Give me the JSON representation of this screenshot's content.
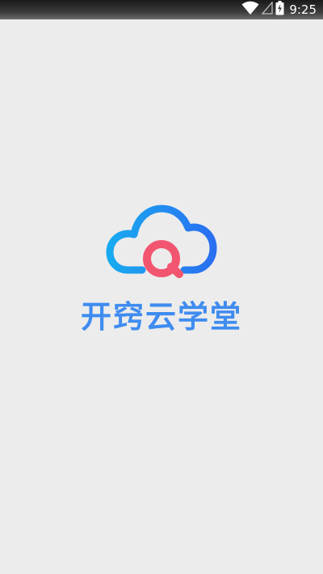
{
  "status_bar": {
    "time": "9:25",
    "icons": [
      "wifi-icon",
      "signal-icon",
      "battery-charging-icon"
    ]
  },
  "splash": {
    "app_name": "开窍云学堂",
    "logo_letter": "Q"
  },
  "colors": {
    "brand_blue": "#3f8cf0",
    "cloud_gradient_start": "#18aaf0",
    "cloud_gradient_end": "#2a6ff0",
    "logo_red": "#f2556f",
    "background": "#ececec"
  }
}
